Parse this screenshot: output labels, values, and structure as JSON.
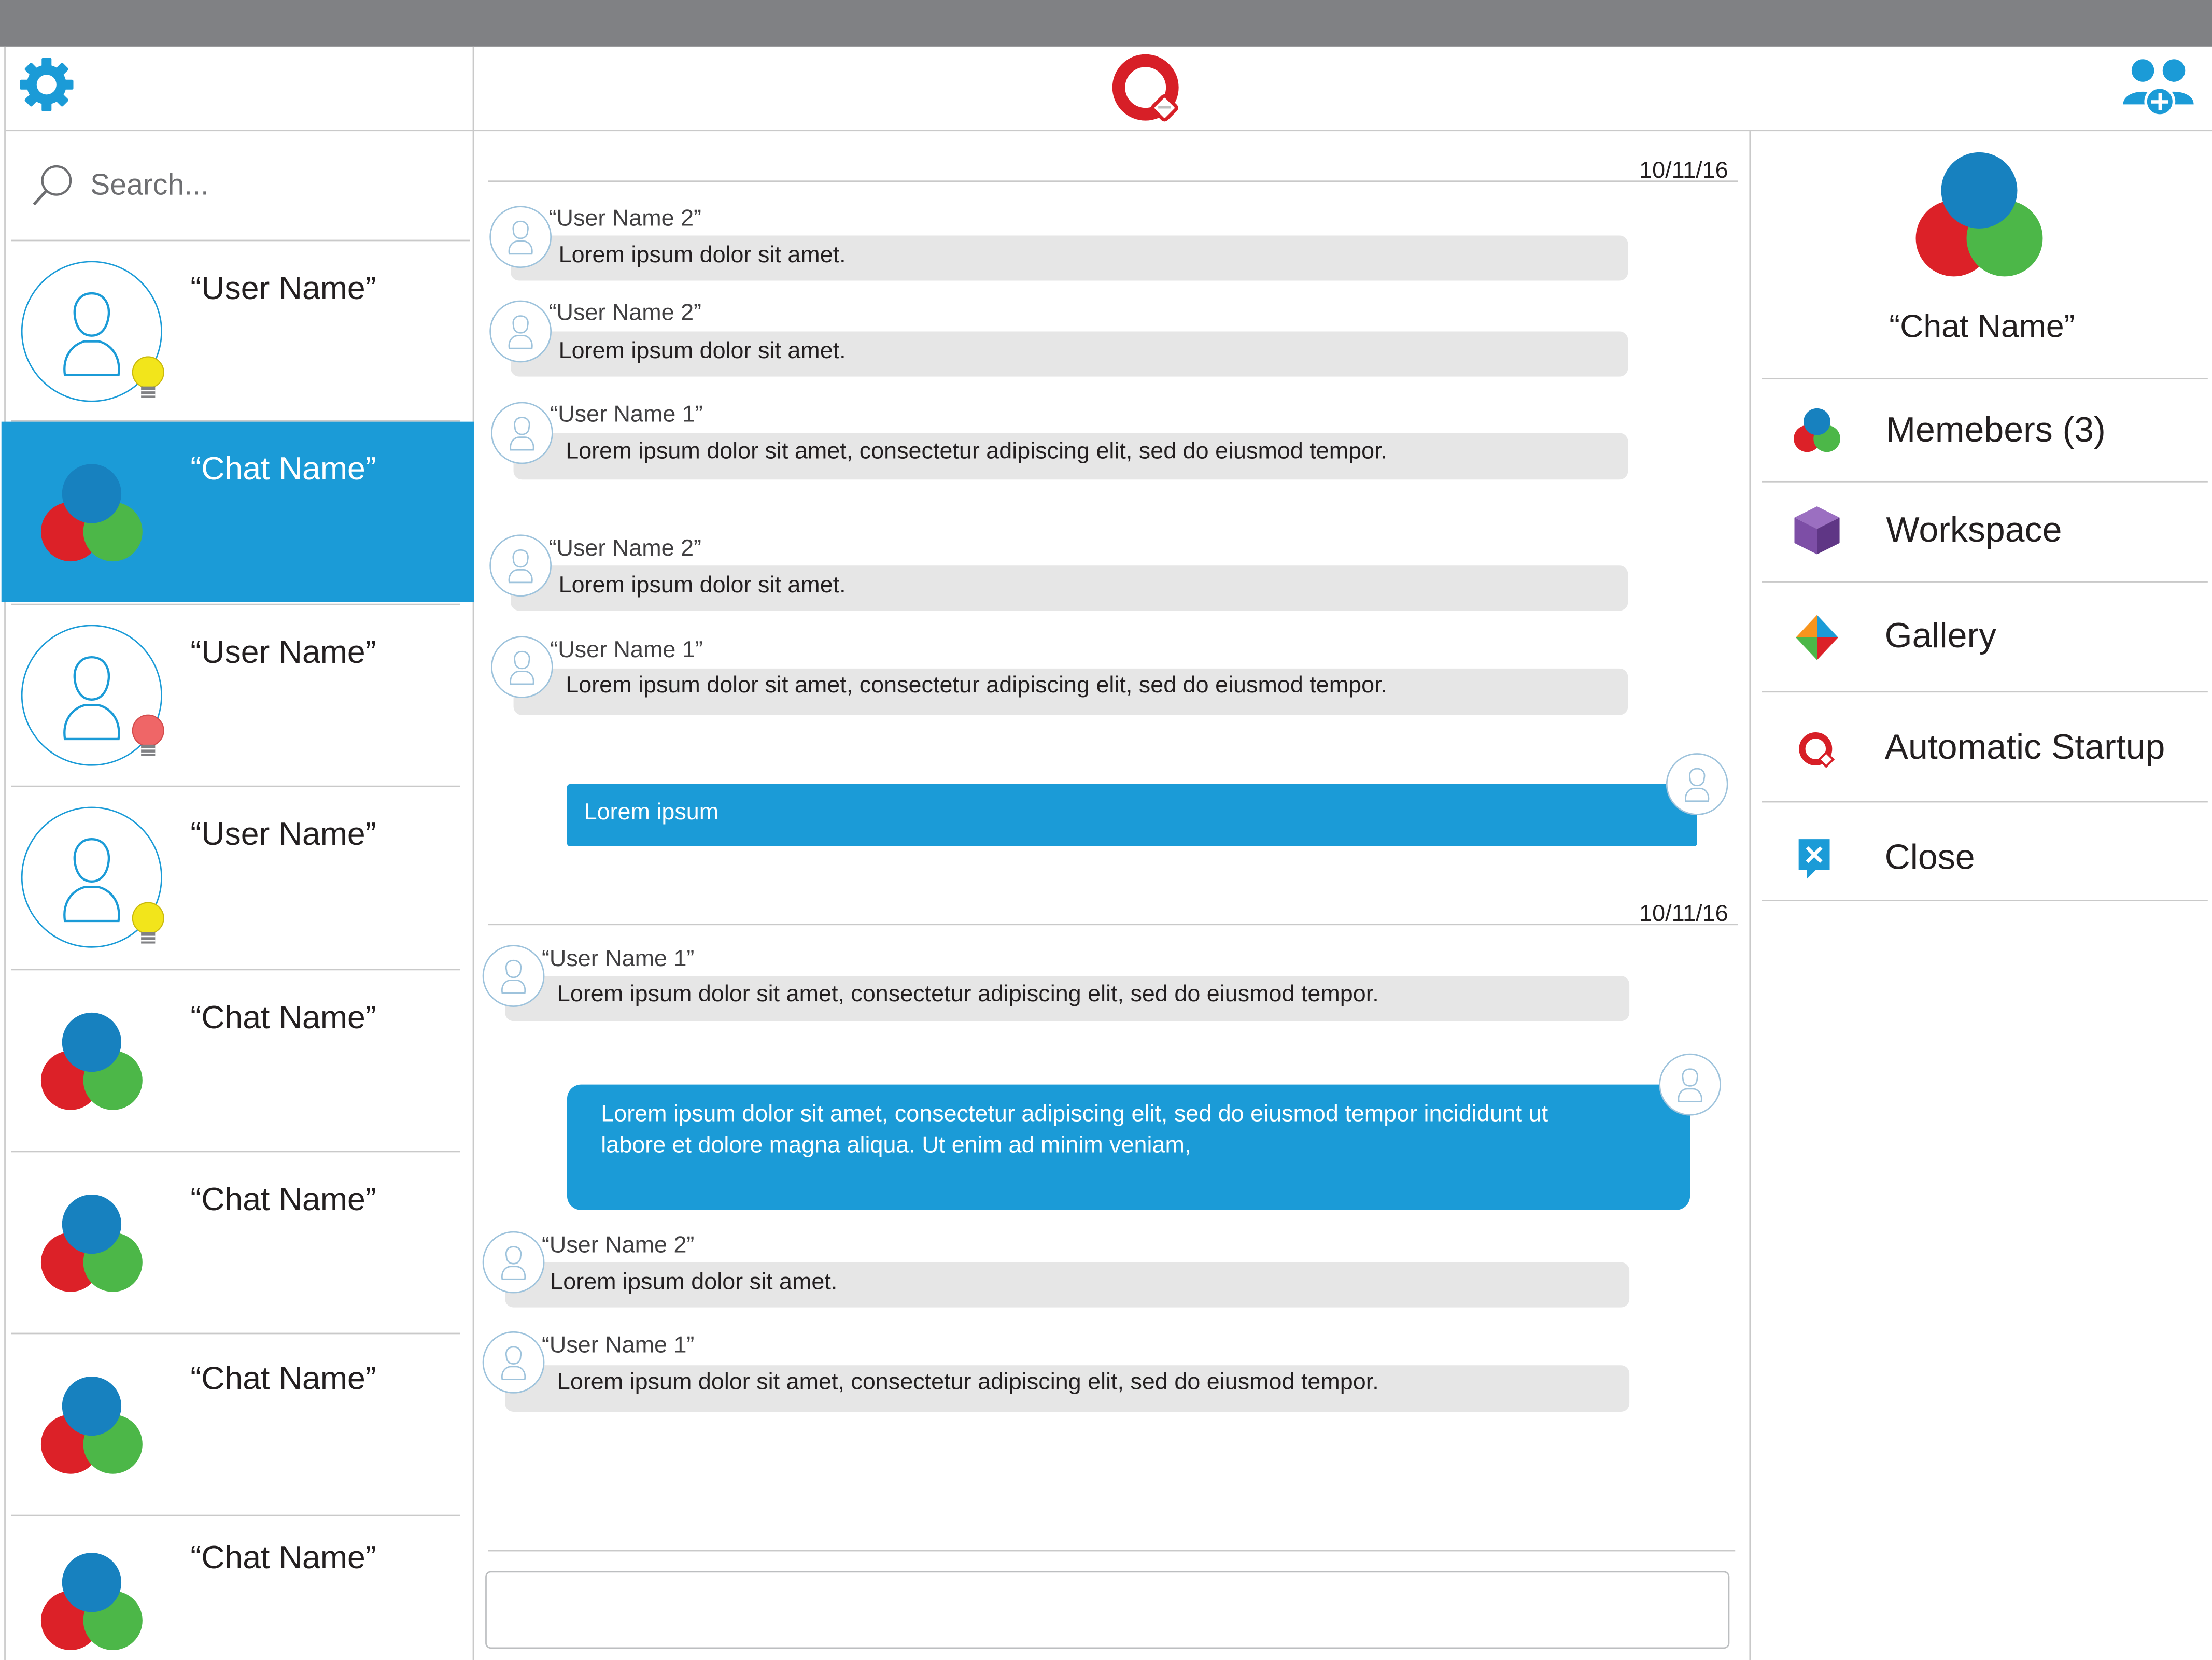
{
  "header": {
    "settings_icon": "gear-icon",
    "logo_icon": "q-logo-icon",
    "add_users_icon": "add-users-icon"
  },
  "search": {
    "placeholder": "Search..."
  },
  "sidebar": {
    "items": [
      {
        "name": "“User Name”",
        "kind": "user",
        "status": "idea-bulb-yellow",
        "status_color": "#f2e51b"
      },
      {
        "name": "“Chat Name”",
        "kind": "group",
        "selected": true
      },
      {
        "name": "“User Name”",
        "kind": "user",
        "status": "idea-bulb-red",
        "status_color": "#ef6667"
      },
      {
        "name": "“User Name”",
        "kind": "user",
        "status": "idea-bulb-yellow",
        "status_color": "#f2e51b"
      },
      {
        "name": "“Chat Name”",
        "kind": "group"
      },
      {
        "name": "“Chat Name”",
        "kind": "group"
      },
      {
        "name": "“Chat Name”",
        "kind": "group"
      },
      {
        "name": "“Chat Name”",
        "kind": "group"
      }
    ]
  },
  "chat": {
    "date1": "10/11/16",
    "date2": "10/11/16",
    "messages": [
      {
        "sender": "“User Name 2”",
        "text": "Lorem ipsum dolor sit amet."
      },
      {
        "sender": "“User Name 2”",
        "text": "Lorem ipsum dolor sit amet."
      },
      {
        "sender": "“User Name 1”",
        "text": "Lorem ipsum dolor sit amet, consectetur adipiscing elit, sed do eiusmod tempor."
      },
      {
        "sender": "“User Name 2”",
        "text": "Lorem ipsum dolor sit amet."
      },
      {
        "sender": "“User Name 1”",
        "text": "Lorem ipsum dolor sit amet, consectetur adipiscing elit, sed do eiusmod tempor."
      },
      {
        "sender": "“User Name 1”",
        "text": "Lorem ipsum dolor sit amet, consectetur adipiscing elit, sed do eiusmod tempor."
      },
      {
        "sender": "“User Name 2”",
        "text": "Lorem ipsum dolor sit amet."
      },
      {
        "sender": "“User Name 1”",
        "text": "Lorem ipsum dolor sit amet, consectetur adipiscing elit, sed do eiusmod tempor."
      }
    ],
    "own_messages": [
      {
        "text": "Lorem ipsum"
      },
      {
        "line1": "Lorem ipsum dolor sit amet, consectetur adipiscing elit, sed do eiusmod tempor incididunt ut",
        "line2": "labore et dolore magna aliqua. Ut enim ad minim veniam,"
      }
    ],
    "composer_value": ""
  },
  "details": {
    "chat_name": "“Chat Name”",
    "menu": [
      {
        "label": "Memebers (3)",
        "icon": "members-icon"
      },
      {
        "label": "Workspace",
        "icon": "cube-icon"
      },
      {
        "label": "Gallery",
        "icon": "gallery-icon"
      },
      {
        "label": "Automatic Startup",
        "icon": "q-logo-icon"
      },
      {
        "label": "Close",
        "icon": "close-icon"
      }
    ]
  },
  "colors": {
    "accent_blue": "#1b9bd7",
    "group_blue": "#1781bf",
    "group_red": "#dc2128",
    "group_green": "#4cb748",
    "logo_red": "#d71f27",
    "topbar_gray": "#808184",
    "bubble_gray": "#e6e6e6"
  }
}
